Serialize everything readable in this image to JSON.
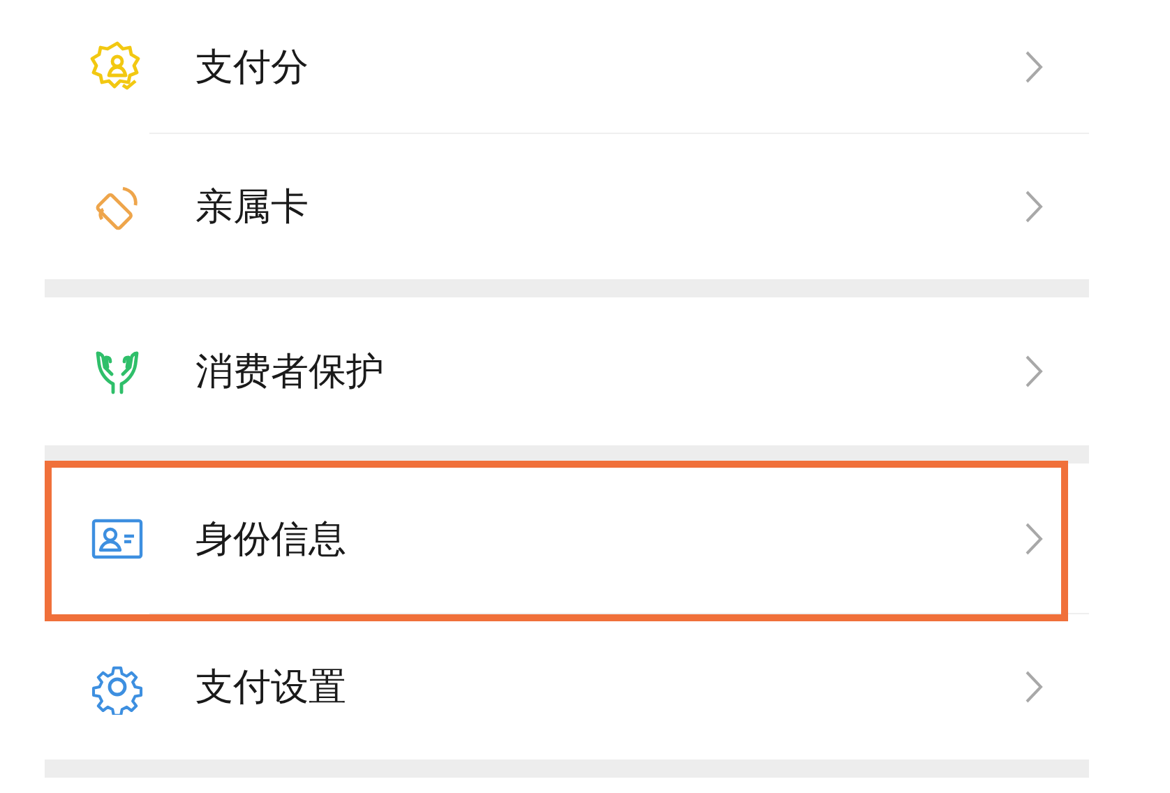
{
  "groups": [
    {
      "items": [
        {
          "label": "支付分",
          "kind": "badge",
          "highlighted": false
        },
        {
          "label": "亲属卡",
          "kind": "card",
          "highlighted": false
        }
      ]
    },
    {
      "items": [
        {
          "label": "消费者保护",
          "kind": "hands",
          "highlighted": false
        }
      ]
    },
    {
      "items": [
        {
          "label": "身份信息",
          "kind": "id",
          "highlighted": true
        },
        {
          "label": "支付设置",
          "kind": "gear",
          "highlighted": false
        }
      ]
    }
  ]
}
